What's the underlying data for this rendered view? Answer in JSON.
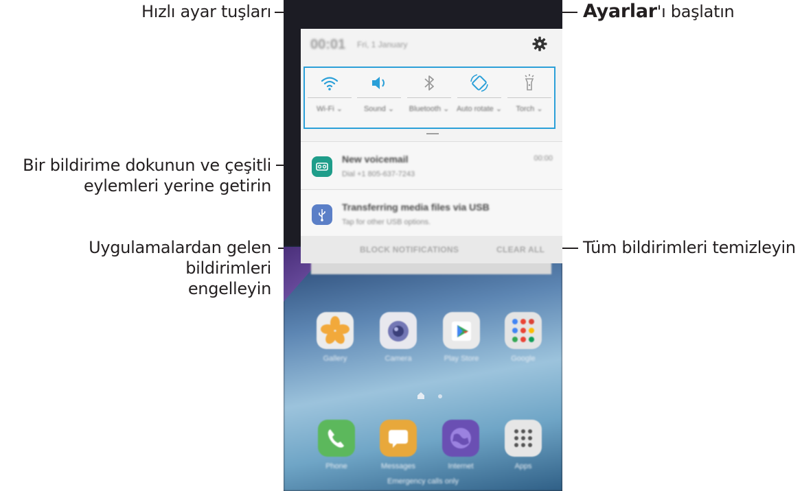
{
  "callouts": {
    "quick_settings": "Hızlı ayar tuşları",
    "settings_bold": "Ayarlar",
    "settings_rest": "'ı başlatın",
    "tap_notification_line1": "Bir bildirime dokunun ve çeşitli",
    "tap_notification_line2": "eylemleri yerine getirin",
    "block_line1": "Uygulamalardan gelen bildirimleri",
    "block_line2": "engelleyin",
    "clear_all": "Tüm bildirimleri temizleyin"
  },
  "status": {
    "time": "00:01",
    "date": "Fri, 1 January"
  },
  "quick_settings": [
    {
      "icon": "wifi-icon",
      "label": "Wi-Fi",
      "color": "#2a9fd8"
    },
    {
      "icon": "sound-icon",
      "label": "Sound",
      "color": "#2a9fd8"
    },
    {
      "icon": "bluetooth-icon",
      "label": "Bluetooth",
      "color": "#9a9a9a"
    },
    {
      "icon": "auto-rotate-icon",
      "label": "Auto rotate",
      "color": "#2a9fd8"
    },
    {
      "icon": "torch-icon",
      "label": "Torch",
      "color": "#9a9a9a"
    }
  ],
  "notifications": [
    {
      "icon": "voicemail-icon",
      "title": "New voicemail",
      "subtitle": "Dial +1 805-637-7243",
      "time": "00:00",
      "color": "#1f9d8a"
    },
    {
      "icon": "usb-icon",
      "title": "Transferring media files via USB",
      "subtitle": "Tap for other USB options.",
      "time": "",
      "color": "#5b7fc7"
    }
  ],
  "actions": {
    "block": "BLOCK NOTIFICATIONS",
    "clear": "CLEAR ALL"
  },
  "home_apps": [
    {
      "label": "Gallery",
      "icon": "gallery-icon"
    },
    {
      "label": "Camera",
      "icon": "camera-icon"
    },
    {
      "label": "Play Store",
      "icon": "play-store-icon"
    },
    {
      "label": "Google",
      "icon": "google-folder-icon"
    }
  ],
  "dock_apps": [
    {
      "label": "Phone",
      "icon": "phone-icon"
    },
    {
      "label": "Messages",
      "icon": "messages-icon"
    },
    {
      "label": "Internet",
      "icon": "internet-icon"
    },
    {
      "label": "Apps",
      "icon": "apps-icon"
    }
  ],
  "emergency": "Emergency calls only",
  "colors": {
    "accent": "#2a9fd8",
    "callout_text": "#231f20"
  }
}
